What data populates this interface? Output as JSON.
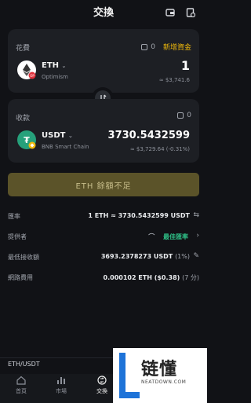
{
  "header": {
    "title": "交換"
  },
  "spend": {
    "label": "花費",
    "wallet_count": "0",
    "deposit": "新增資金",
    "token": "ETH",
    "chain": "Optimism",
    "amount": "1",
    "fiat": "≈ $3,741.6"
  },
  "receive": {
    "label": "收款",
    "wallet_count": "0",
    "token": "USDT",
    "chain": "BNB Smart Chain",
    "amount": "3730.5432599",
    "fiat": "≈ $3,729.64 (-0.31%)"
  },
  "cta": {
    "label": "ETH 餘額不足"
  },
  "details": {
    "rate_label": "匯率",
    "rate_value": "1 ETH ≈ 3730.5432599 USDT",
    "provider_label": "提供者",
    "provider_value": "最佳匯率",
    "min_label": "最低接收額",
    "min_value": "3693.2378273 USDT",
    "min_pct": "(1%)",
    "fee_label": "網路費用",
    "fee_value": "0.000102 ETH ($0.38)",
    "fee_time": "(7 分)"
  },
  "pair": "ETH/USDT",
  "nav": [
    {
      "label": "首頁"
    },
    {
      "label": "市場"
    },
    {
      "label": "交換"
    }
  ],
  "watermark": {
    "text": "链懂",
    "url": "NEATDOWN.COM"
  },
  "colors": {
    "accent": "#f0b90b",
    "green": "#2ebd85",
    "red": "#e0313b",
    "tether": "#26a17b"
  }
}
